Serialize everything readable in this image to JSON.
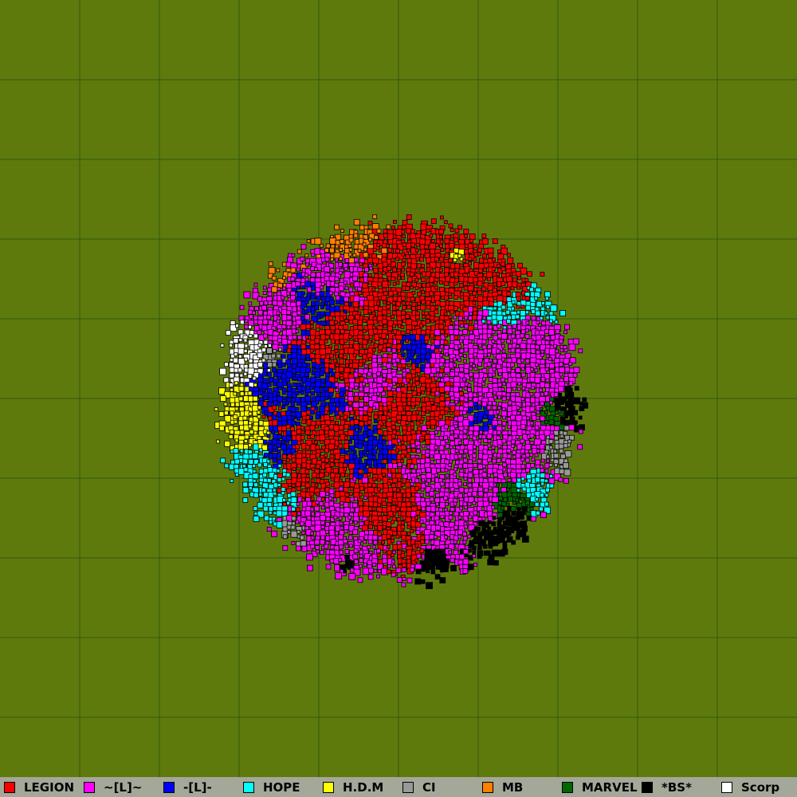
{
  "map": {
    "background_color": "#5f7a0c",
    "grid_color": "#2f5a10",
    "grid_cell_count": 10
  },
  "legend": {
    "background_color": "#a4a899",
    "items": [
      {
        "label": "LEGION",
        "color": "#ff0000"
      },
      {
        "label": "~[L]~",
        "color": "#ff00ff"
      },
      {
        "label": "-[L]-",
        "color": "#0000ff"
      },
      {
        "label": "HOPE",
        "color": "#00ffff"
      },
      {
        "label": "H.D.M",
        "color": "#ffff00"
      },
      {
        "label": "CI",
        "color": "#999999"
      },
      {
        "label": "MB",
        "color": "#ff8000"
      },
      {
        "label": "MARVEL",
        "color": "#006600"
      },
      {
        "label": "*BS*",
        "color": "#000000"
      },
      {
        "label": "Scorp",
        "color": "#ffffff"
      }
    ]
  }
}
